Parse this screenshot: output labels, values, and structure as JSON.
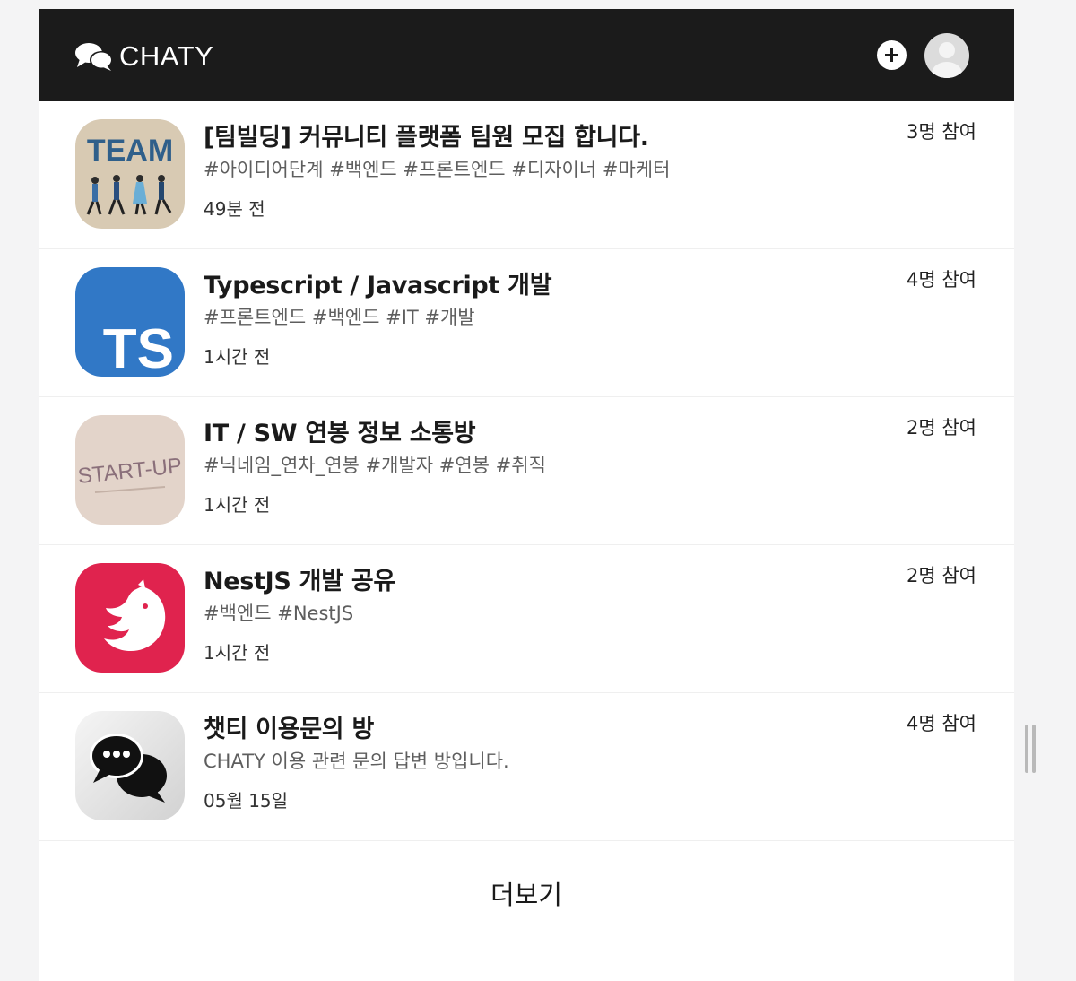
{
  "header": {
    "brand_name": "CHATY",
    "brand_icon": "chat-bubbles-icon",
    "add_icon": "plus-circle-icon",
    "avatar_icon": "user-avatar-icon"
  },
  "rooms": [
    {
      "title": "[팀빌딩] 커뮤니티 플랫폼 팀원 모집 합니다.",
      "tags": "#아이디어단계 #백엔드 #프론트엔드 #디자이너 #마케터",
      "time": "49분 전",
      "participants": "3명 참여",
      "thumb_text": "TEAM"
    },
    {
      "title": "Typescript / Javascript 개발",
      "tags": "#프론트엔드 #백엔드 #IT #개발",
      "time": "1시간 전",
      "participants": "4명 참여",
      "thumb_text": "TS"
    },
    {
      "title": "IT / SW 연봉 정보 소통방",
      "tags": "#닉네임_연차_연봉 #개발자 #연봉 #취직",
      "time": "1시간 전",
      "participants": "2명 참여",
      "thumb_text": "START-UP"
    },
    {
      "title": "NestJS 개발 공유",
      "tags": "#백엔드 #NestJS",
      "time": "1시간 전",
      "participants": "2명 참여",
      "thumb_text": ""
    },
    {
      "title": "챗티 이용문의 방",
      "tags": "CHATY 이용 관련 문의 답변 방입니다.",
      "time": "05월 15일",
      "participants": "4명 참여",
      "thumb_text": ""
    }
  ],
  "more_label": "더보기",
  "colors": {
    "header_bg": "#1b1b1b",
    "ts_blue": "#3178c6",
    "nest_red": "#e0234e"
  }
}
